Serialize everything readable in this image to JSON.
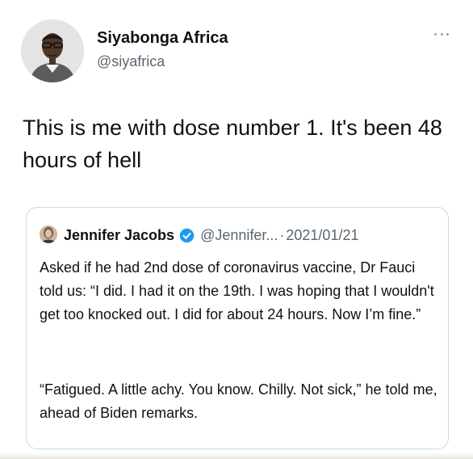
{
  "tweet": {
    "author": {
      "display_name": "Siyabonga Africa",
      "handle": "@siyafrica",
      "avatar_icon": "avatar-photo"
    },
    "more_icon": "more-horizontal-icon",
    "text": "This is me with dose number 1. It's been 48 hours of hell"
  },
  "quoted_tweet": {
    "author": {
      "display_name": "Jennifer Jacobs",
      "handle": "@Jennifer...",
      "verified": true,
      "avatar_icon": "avatar-photo"
    },
    "separator": "·",
    "date": "2021/01/21",
    "paragraphs": [
      "Asked if he had 2nd dose of coronavirus vaccine, Dr Fauci told us: “I did. I had it on the 19th. I was hoping that I wouldn't get too knocked out. I did for about 24 hours. Now I’m fine.”",
      "“Fatigued. A little achy. You know. Chilly. Not sick,” he told me, ahead of Biden remarks."
    ]
  },
  "colors": {
    "verified_blue": "#1d9bf0",
    "secondary_text": "#5b6670",
    "border": "#cfd9de"
  }
}
